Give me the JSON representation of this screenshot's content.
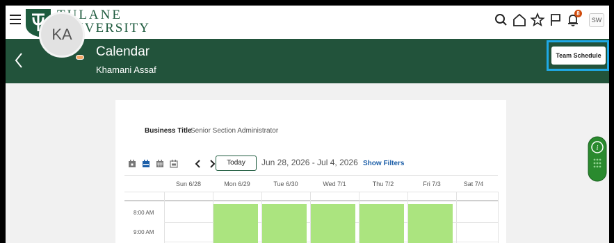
{
  "header": {
    "university_line1": "TULANE",
    "university_line2": "UNIVERSITY",
    "notification_count": "8",
    "user_initials": "SW",
    "icons": [
      "menu-icon",
      "search-icon",
      "home-icon",
      "star-icon",
      "flag-icon",
      "bell-icon"
    ],
    "brand_color": "#22533b"
  },
  "banner": {
    "title": "Calendar",
    "person_name": "Khamani Assaf",
    "avatar_initials": "KA",
    "team_schedule_label": "Team Schedule",
    "highlight_color": "#1fa9e6"
  },
  "card": {
    "business_title_label": "Business Title",
    "business_title_value": "Senior Section Administrator"
  },
  "calendar": {
    "today_label": "Today",
    "date_range": "Jun 28, 2026 - Jul 4, 2026",
    "show_filters_label": "Show Filters",
    "days": [
      "Sun 6/28",
      "Mon 6/29",
      "Tue 6/30",
      "Wed 7/1",
      "Thu 7/2",
      "Fri 7/3",
      "Sat 7/4"
    ],
    "times": [
      "8:00 AM",
      "9:00 AM"
    ],
    "busy_days": [
      "Mon 6/29",
      "Tue 6/30",
      "Wed 7/1",
      "Thu 7/2",
      "Fri 7/3"
    ],
    "busy_color": "#abe47f"
  }
}
